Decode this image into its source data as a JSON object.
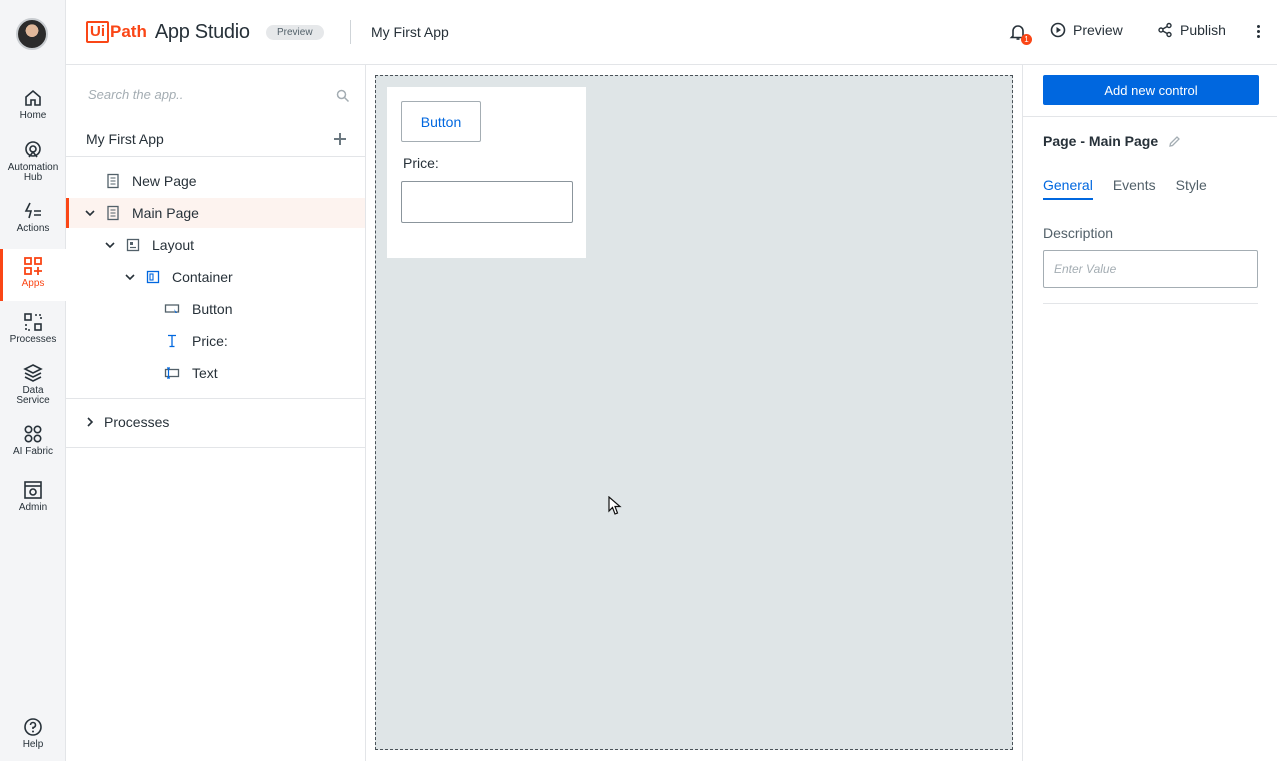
{
  "rail": {
    "items": [
      {
        "label": "Home",
        "icon": "home-icon"
      },
      {
        "label": "Automation Hub",
        "line1": "Automation",
        "line2": "Hub",
        "icon": "automation-hub-icon"
      },
      {
        "label": "Actions",
        "icon": "actions-icon"
      },
      {
        "label": "Apps",
        "icon": "apps-icon",
        "active": true
      },
      {
        "label": "Processes",
        "icon": "processes-icon"
      },
      {
        "label": "Data Service",
        "line1": "Data",
        "line2": "Service",
        "icon": "data-service-icon"
      },
      {
        "label": "AI Fabric",
        "icon": "ai-fabric-icon"
      },
      {
        "label": "Admin",
        "icon": "admin-icon"
      },
      {
        "label": "Help",
        "icon": "help-icon"
      }
    ]
  },
  "topbar": {
    "logo_ui": "Ui",
    "logo_path": "Path",
    "product": "App Studio",
    "preview_badge": "Preview",
    "app_name": "My First App",
    "notification_count": "1",
    "preview_label": "Preview",
    "publish_label": "Publish"
  },
  "explorer": {
    "search_placeholder": "Search the app..",
    "app_name": "My First App",
    "tree": [
      {
        "label": "New Page",
        "type": "page"
      },
      {
        "label": "Main Page",
        "type": "page",
        "expanded": true,
        "selected": true
      },
      {
        "label": "Layout",
        "type": "layout",
        "expanded": true
      },
      {
        "label": "Container",
        "type": "container",
        "expanded": true
      },
      {
        "label": "Button",
        "type": "button"
      },
      {
        "label": "Price:",
        "type": "label"
      },
      {
        "label": "Text",
        "type": "textbox"
      }
    ],
    "processes_label": "Processes"
  },
  "canvas": {
    "button_label": "Button",
    "price_label": "Price:"
  },
  "properties": {
    "add_control_label": "Add new control",
    "page_title": "Page - Main Page",
    "tabs": [
      "General",
      "Events",
      "Style"
    ],
    "active_tab": "General",
    "description_label": "Description",
    "description_placeholder": "Enter Value"
  },
  "colors": {
    "brand_orange": "#fa4616",
    "primary_blue": "#0067df",
    "canvas_bg": "#dfe5e7"
  }
}
